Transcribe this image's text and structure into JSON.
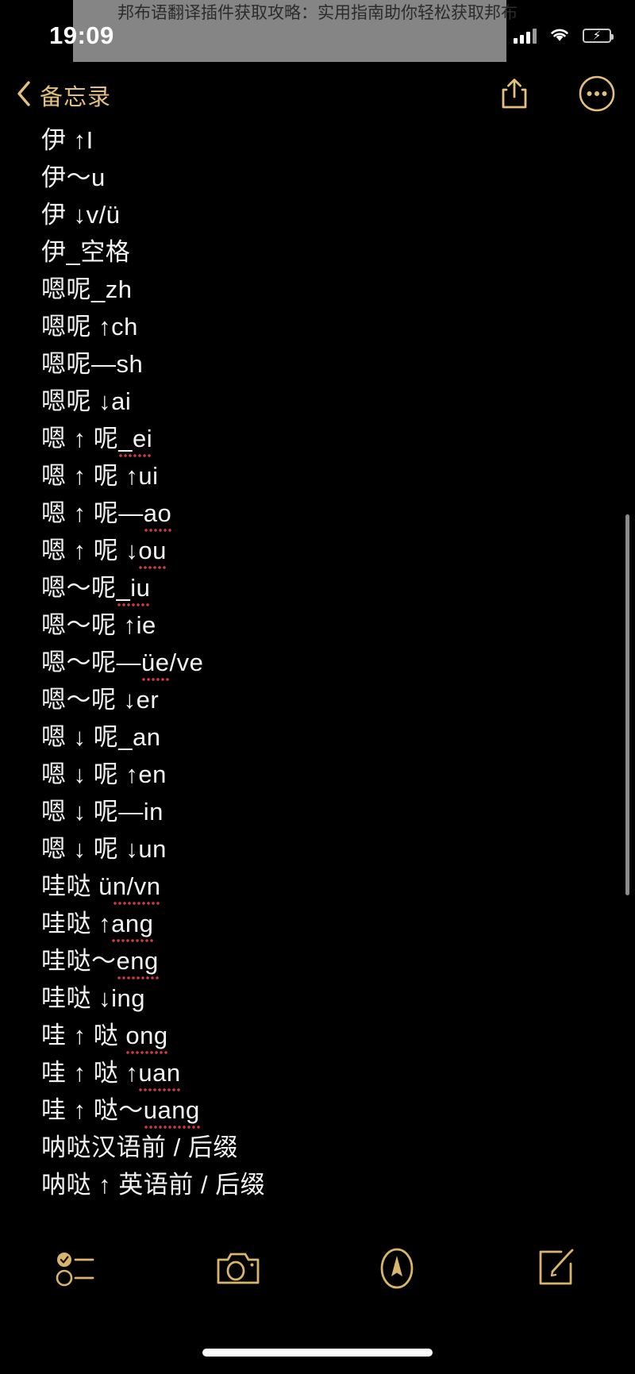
{
  "banner": {
    "text": "邦布语翻译插件获取攻略：实用指南助你轻松获取邦布"
  },
  "status_bar": {
    "time": "19:09",
    "signal_icon": "cellular-signal-icon",
    "wifi_icon": "wifi-icon",
    "battery_icon": "battery-charging-icon",
    "battery_charging_glyph": "⚡"
  },
  "nav_bar": {
    "back_label": "备忘录",
    "back_icon": "chevron-left-icon",
    "share_icon": "share-icon",
    "more_icon": "more-circle-icon",
    "accent_color": "#e3c07b"
  },
  "note": {
    "lines": [
      {
        "text": "伊 ↑I",
        "misspelled": false
      },
      {
        "text": "伊～u",
        "misspelled": false
      },
      {
        "text": "伊 ↓v/ü",
        "misspelled": false
      },
      {
        "text": "伊_空格",
        "misspelled": false
      },
      {
        "text": "嗯呢_zh",
        "misspelled": false
      },
      {
        "text": "嗯呢 ↑ch",
        "misspelled": false
      },
      {
        "text": "嗯呢—sh",
        "misspelled": false
      },
      {
        "text": "嗯呢 ↓ai",
        "misspelled": false
      },
      {
        "text": "嗯 ↑ 呢_ei",
        "misspelled": true,
        "mark": "_ei"
      },
      {
        "text": "嗯 ↑ 呢 ↑ui",
        "misspelled": false
      },
      {
        "text": "嗯 ↑ 呢—ao",
        "misspelled": true,
        "mark": "ao"
      },
      {
        "text": "嗯 ↑ 呢 ↓ou",
        "misspelled": true,
        "mark": "ou"
      },
      {
        "text": "嗯～呢_iu",
        "misspelled": true,
        "mark": "_iu"
      },
      {
        "text": "嗯～呢 ↑ie",
        "misspelled": false
      },
      {
        "text": "嗯～呢—üe/ve",
        "misspelled": true,
        "mark": "üe"
      },
      {
        "text": "嗯～呢 ↓er",
        "misspelled": false
      },
      {
        "text": "嗯 ↓ 呢_an",
        "misspelled": false
      },
      {
        "text": "嗯 ↓ 呢 ↑en",
        "misspelled": false
      },
      {
        "text": "嗯 ↓ 呢—in",
        "misspelled": false
      },
      {
        "text": "嗯 ↓ 呢 ↓un",
        "misspelled": false
      },
      {
        "text": "哇哒 ün/vn",
        "misspelled": true,
        "mark": "n/vn"
      },
      {
        "text": "哇哒 ↑ang",
        "misspelled": true,
        "mark": "ang"
      },
      {
        "text": "哇哒～eng",
        "misspelled": true,
        "mark": "eng"
      },
      {
        "text": "哇哒 ↓ing",
        "misspelled": false
      },
      {
        "text": "哇 ↑ 哒 ong",
        "misspelled": true,
        "mark": "ong"
      },
      {
        "text": "哇 ↑ 哒 ↑uan",
        "misspelled": true,
        "mark": "uan"
      },
      {
        "text": "哇 ↑ 哒～uang",
        "misspelled": true,
        "mark": "uang"
      },
      {
        "text": "呐哒汉语前 / 后缀",
        "misspelled": false
      },
      {
        "text": "呐哒 ↑ 英语前 / 后缀",
        "misspelled": false
      }
    ]
  },
  "toolbar": {
    "items": [
      {
        "icon": "checklist-icon",
        "name": "checklist-button"
      },
      {
        "icon": "camera-icon",
        "name": "camera-button"
      },
      {
        "icon": "markup-pen-icon",
        "name": "markup-button"
      },
      {
        "icon": "compose-icon",
        "name": "compose-button"
      }
    ],
    "accent_color": "#d8b56a"
  },
  "scroll": {
    "indicator": "vertical-scroll-indicator"
  }
}
